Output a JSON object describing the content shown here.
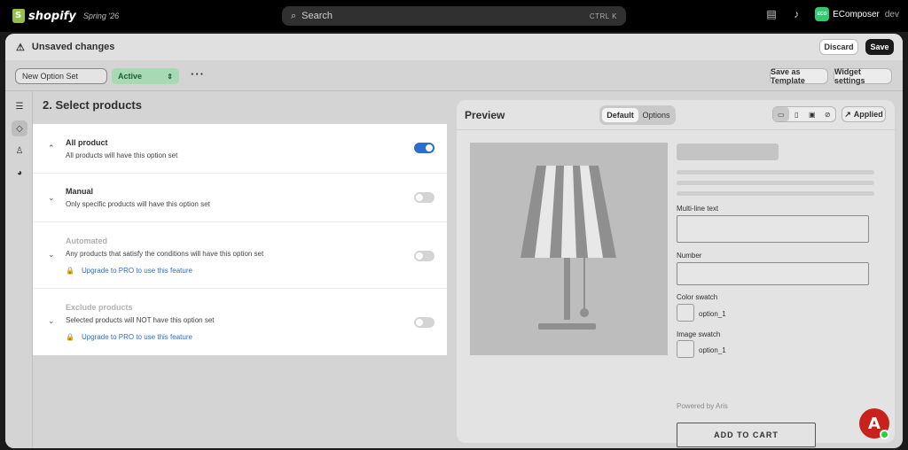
{
  "topbar": {
    "brand": "shopify",
    "edition": "Spring '26",
    "search_placeholder": "Search",
    "search_shortcut": "CTRL  K",
    "store_badge": "ECO",
    "store_name": "EComposer",
    "store_env": "dev",
    "icons": [
      "store-icon",
      "bell-icon"
    ]
  },
  "unsaved_bar": {
    "message": "Unsaved changes",
    "discard_label": "Discard",
    "save_label": "Save"
  },
  "toolbar": {
    "option_set_name": "New Option Set",
    "status": "Active",
    "more_label": "···",
    "save_template_label": "Save as Template",
    "widget_settings_label": "Widget settings"
  },
  "sidebar": {
    "items": [
      {
        "icon": "list-icon"
      },
      {
        "icon": "tag-icon",
        "active": true
      },
      {
        "icon": "person-icon"
      },
      {
        "icon": "globe-icon"
      }
    ]
  },
  "select_products": {
    "title": "2. Select products",
    "options": [
      {
        "title": "All product",
        "desc": "All products will have this option set",
        "enabled": true,
        "disabled": false
      },
      {
        "title": "Manual",
        "desc": "Only specific products will have this option set",
        "enabled": false,
        "disabled": false
      },
      {
        "title": "Automated",
        "desc": "Any products that satisfy the conditions will have this option set",
        "upgrade": "Upgrade to PRO to use this feature",
        "enabled": false,
        "disabled": true
      },
      {
        "title": "Exclude products",
        "desc": "Selected products will NOT have this option set",
        "upgrade": "Upgrade to PRO to use this feature",
        "enabled": false,
        "disabled": true
      }
    ]
  },
  "preview": {
    "title": "Preview",
    "tabs": [
      "Default",
      "Options"
    ],
    "selected_tab": "Default",
    "applied_label": "Applied",
    "device_icons": [
      "desktop-icon",
      "mobile-icon",
      "tablet-icon",
      "hide-icon"
    ],
    "fields": {
      "multiline_label": "Multi-line text",
      "number_label": "Number",
      "color_swatch_label": "Color swatch",
      "color_swatch_option": "option_1",
      "image_swatch_label": "Image swatch",
      "image_swatch_option": "option_1"
    },
    "powered_by": "Powered by Aris",
    "add_to_cart": "ADD TO CART"
  },
  "fab": {
    "label": "A"
  },
  "colors": {
    "toggle_on": "#2c6ecb",
    "status_bg": "#a7d9b5",
    "link": "#2c6ecb",
    "fab": "#c8221c"
  }
}
